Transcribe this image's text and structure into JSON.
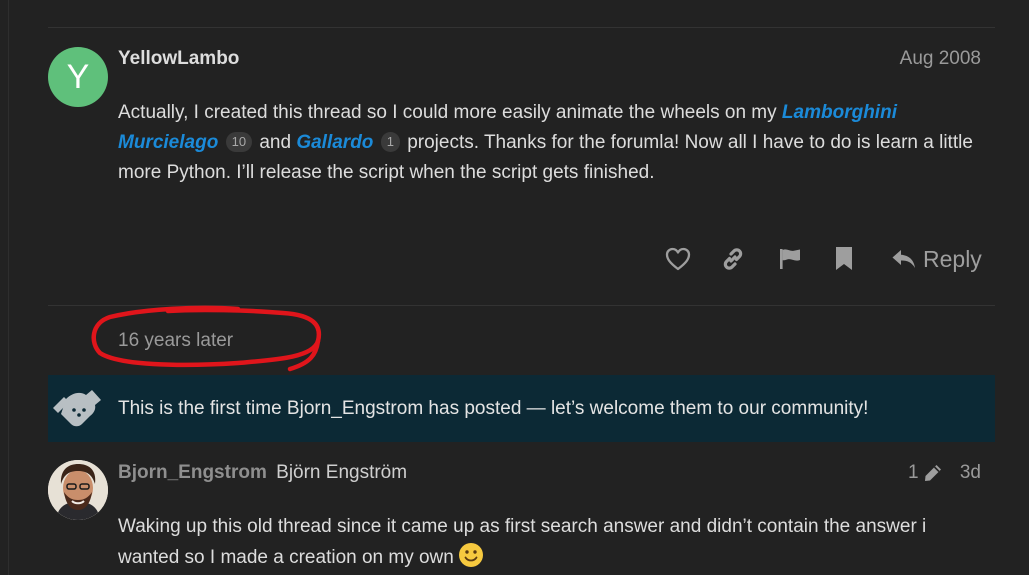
{
  "post1": {
    "avatar_letter": "Y",
    "avatar_color": "#5fc07b",
    "username": "YellowLambo",
    "date": "Aug 2008",
    "text_a": "Actually, I created this thread so I could more easily animate the wheels on my ",
    "link1": "Lamborghini Murcielago",
    "link1_count": "10",
    "text_b": " and ",
    "link2": "Gallardo",
    "link2_count": "1",
    "text_c": " projects. Thanks for the forumla! Now all I have to do is learn a little more Python. I’ll release the script when the script gets finished."
  },
  "actions": {
    "like_icon": "heart-icon",
    "share_icon": "link-icon",
    "flag_icon": "flag-icon",
    "bookmark_icon": "bookmark-icon",
    "reply_label": "Reply"
  },
  "time_gap": "16 years later",
  "welcome": {
    "icon": "handshake-icon",
    "text": "This is the first time Bjorn_Engstrom has posted — let’s welcome them to our community!"
  },
  "post2": {
    "username": "Bjorn_Engstrom",
    "full_name": "Björn Engström",
    "edit_count": "1",
    "date": "3d",
    "text": "Waking up this old thread since it came up as first search answer and didn’t contain the answer i wanted so I made a creation on my own"
  },
  "colors": {
    "background": "#222222",
    "link": "#1b8ad8",
    "welcome_bg": "#0c2935",
    "annotation": "#e0151b"
  }
}
